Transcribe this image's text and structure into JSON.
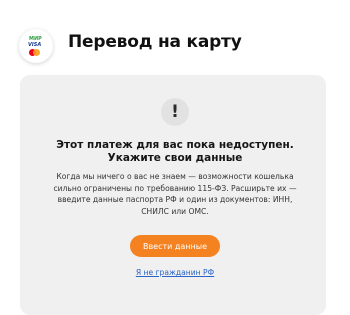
{
  "header": {
    "title": "Перевод на карту",
    "card_icon": {
      "mir_label": "МИР",
      "visa_label": "VISA"
    }
  },
  "notice": {
    "icon": "exclamation-icon",
    "icon_glyph": "!",
    "heading_line1": "Этот платеж для вас пока недоступен.",
    "heading_line2": "Укажите свои данные",
    "body_line1": "Когда мы ничего о вас не знаем — возможности кошелька",
    "body_line2": "сильно ограничены по требованию 115-ФЗ. Расширьте их —",
    "body_line3": "введите данные паспорта РФ и один из документов: ИНН,",
    "body_line4": "СНИЛС или ОМС."
  },
  "actions": {
    "primary_label": "Ввести данные",
    "link_label": "Я не гражданин РФ"
  },
  "colors": {
    "accent": "#f58220",
    "link": "#2b63c7",
    "panel_background": "#f0f0f0"
  }
}
